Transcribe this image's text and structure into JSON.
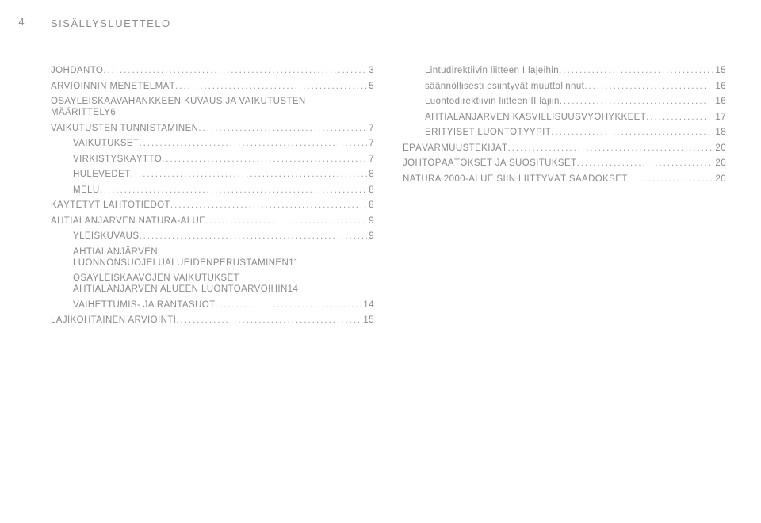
{
  "header": {
    "page_number": "4",
    "title": "SISÄLLYSLUETTELO"
  },
  "left_column": [
    {
      "indent": 0,
      "label": "JOHDANTO",
      "page": "3"
    },
    {
      "indent": 0,
      "label": "ARVIOINNIN MENETELMÄT",
      "page": "5"
    },
    {
      "indent": 0,
      "multi": true,
      "line1": "OSAYLEISKAAVAHANKKEEN KUVAUS JA VAIKUTUSTEN",
      "line2": "MÄÄRITTELY",
      "page": "6"
    },
    {
      "indent": 0,
      "label": "VAIKUTUSTEN TUNNISTAMINEN",
      "page": "7"
    },
    {
      "indent": 1,
      "label": "VAIKUTUKSET",
      "page": "7"
    },
    {
      "indent": 1,
      "label": "VIRKISTYSKÄYTTÖ",
      "page": "7"
    },
    {
      "indent": 1,
      "label": "HULEVEDET",
      "page": "8"
    },
    {
      "indent": 1,
      "label": "MELU",
      "page": "8"
    },
    {
      "indent": 0,
      "label": "KÄYTETYT LÄHTÖTIEDOT",
      "page": "8"
    },
    {
      "indent": 0,
      "label": "AHTIALANJÄRVEN NATURA-ALUE",
      "page": "9"
    },
    {
      "indent": 1,
      "label": "YLEISKUVAUS",
      "page": "9"
    },
    {
      "indent": 1,
      "multi": true,
      "line1": "AHTIALANJÄRVEN",
      "line2": "LUONNONSUOJELUALUEIDENPERUSTAMINEN",
      "page": "11"
    },
    {
      "indent": 1,
      "multi": true,
      "line1": "OSAYLEISKAAVOJEN VAIKUTUKSET",
      "line2": "AHTIALANJÄRVEN ALUEEN LUONTOARVOIHIN",
      "page": "14"
    },
    {
      "indent": 1,
      "label": "VAIHETTUMIS- JA RANTASUOT",
      "page": "14"
    },
    {
      "indent": 0,
      "label": "LAJIKOHTAINEN ARVIOINTI",
      "page": "15"
    }
  ],
  "right_column": [
    {
      "indent": 1,
      "label": "Lintudirektiivin liitteen I lajeihin",
      "page": "15"
    },
    {
      "indent": 1,
      "label": "säännöllisesti esiintyvät muuttolinnut",
      "page": "16"
    },
    {
      "indent": 1,
      "label": "Luontodirektiivin liitteen II lajiin",
      "page": "16"
    },
    {
      "indent": 1,
      "label": "AHTIALANJÄRVEN KASVILLISUUSVYÖHYKKEET",
      "page": "17"
    },
    {
      "indent": 1,
      "label": "ERITYISET LUONTOTYYPIT",
      "page": "18"
    },
    {
      "indent": 0,
      "label": "EPÄVARMUUSTEKIJÄT",
      "page": "20"
    },
    {
      "indent": 0,
      "label": "JOHTOPÄÄTÖKSET JA SUOSITUKSET",
      "page": "20"
    },
    {
      "indent": 0,
      "label": "NATURA 2000-ALUEISIIN LIITTYVÄT SÄÄDÖKSET",
      "page": "20"
    }
  ]
}
